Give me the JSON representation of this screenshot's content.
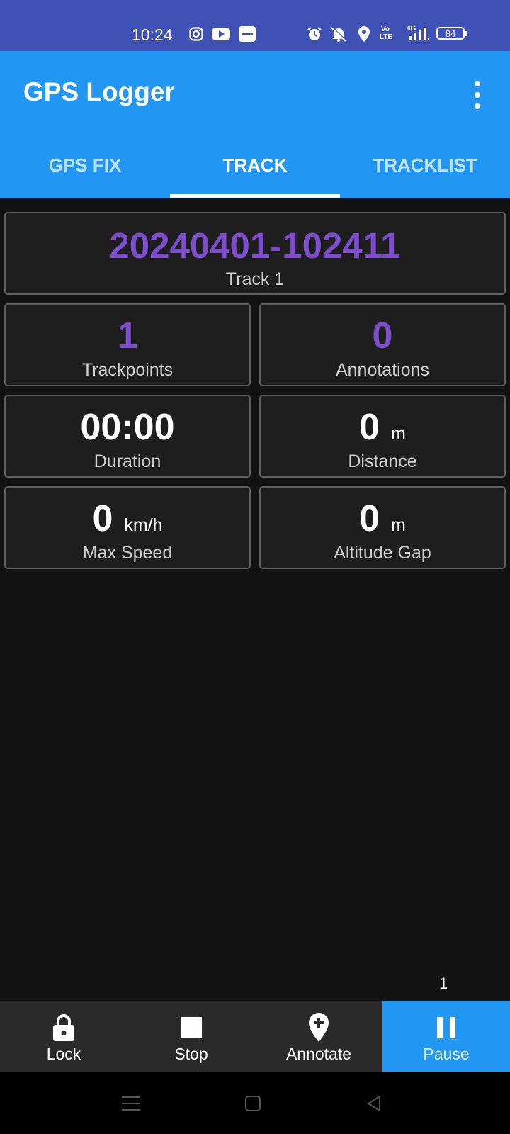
{
  "status_bar": {
    "time": "10:24",
    "battery": "84",
    "network_vo": "Vo",
    "network_lte": "LTE",
    "network_4g": "4G",
    "icons": [
      "instagram-icon",
      "youtube-icon",
      "zomato-icon",
      "alarm-icon",
      "mute-icon",
      "location-icon",
      "volte-icon",
      "signal-icon",
      "battery-icon"
    ]
  },
  "app_bar": {
    "title": "GPS Logger",
    "tabs": [
      {
        "label": "GPS FIX",
        "active": false
      },
      {
        "label": "TRACK",
        "active": true
      },
      {
        "label": "TRACKLIST",
        "active": false
      }
    ]
  },
  "track": {
    "name": "20240401-102411",
    "name_label": "Track 1",
    "trackpoints": "1",
    "trackpoints_label": "Trackpoints",
    "annotations": "0",
    "annotations_label": "Annotations",
    "duration": "00:00",
    "duration_label": "Duration",
    "distance": "0",
    "distance_unit": "m",
    "distance_label": "Distance",
    "max_speed": "0",
    "max_speed_unit": "km/h",
    "max_speed_label": "Max Speed",
    "altitude_gap": "0",
    "altitude_gap_unit": "m",
    "altitude_gap_label": "Altitude Gap"
  },
  "page_count": "1",
  "actions": {
    "lock": "Lock",
    "stop": "Stop",
    "annotate": "Annotate",
    "pause": "Pause"
  },
  "colors": {
    "status_bar": "#3f51b5",
    "primary": "#2196f3",
    "accent_purple": "#7c4dcc",
    "background": "#121212"
  }
}
